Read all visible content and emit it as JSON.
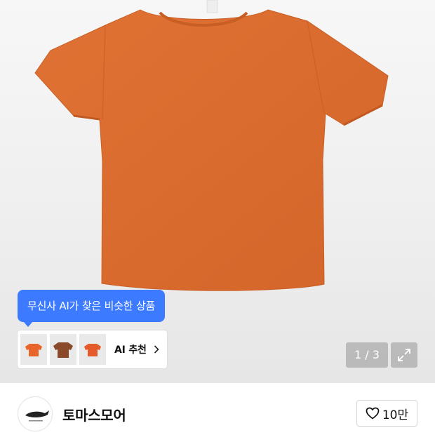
{
  "product": {
    "image_icon": "orange-tshirt-photo",
    "tooltip": "무신사 AI가 찾은 비슷한 상품",
    "ai_recommend": {
      "label": "AI 추천",
      "thumbnails": [
        {
          "icon": "tshirt-icon",
          "color": "#e8642a"
        },
        {
          "icon": "tshirt-icon",
          "color": "#8a4a2a"
        },
        {
          "icon": "tshirt-icon",
          "color": "#e45a2a"
        }
      ]
    },
    "gallery": {
      "counter": "1 / 3"
    }
  },
  "store": {
    "name": "토마스모어",
    "like_count": "10만"
  },
  "colors": {
    "accent_blue": "#3c7bff",
    "shirt_orange": "#dd6a2c"
  }
}
